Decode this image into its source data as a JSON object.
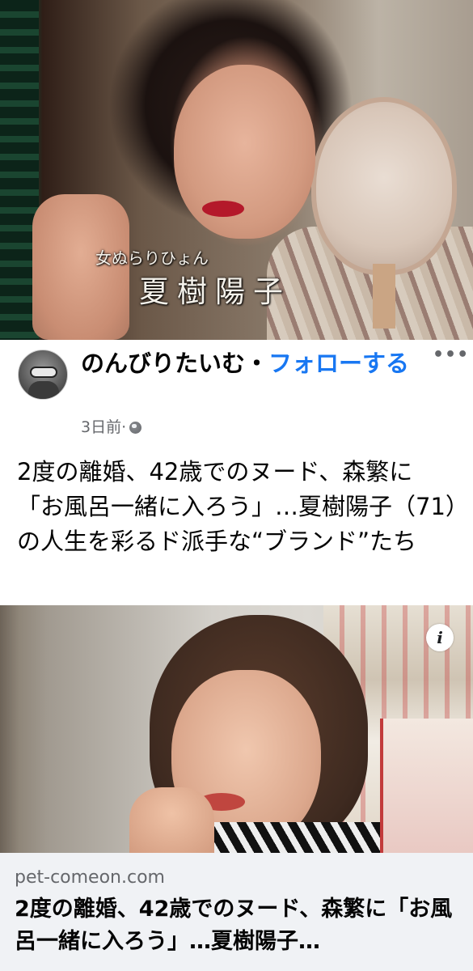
{
  "video_still": {
    "caption_small": "女ぬらりひょん",
    "caption_big": "夏樹陽子"
  },
  "post": {
    "author": "のんびりたいむ",
    "separator": "・",
    "follow_label": "フォローする",
    "more_label": "•••",
    "time": "3日前",
    "time_separator": " · ",
    "privacy_icon": "globe-icon",
    "text": "2度の離婚、42歳でのヌード、森繁に「お風呂一緒に入ろう」…夏樹陽子（71）の人生を彩るド派手な“ブランド”たち"
  },
  "link_preview": {
    "info_label": "i",
    "domain": "pet-comeon.com",
    "title": "2度の離婚、42歳でのヌード、森繁に「お風呂一緒に入ろう」…夏樹陽子…"
  },
  "colors": {
    "link_blue": "#1877f2",
    "secondary_text": "#65676b",
    "footer_bg": "#f0f2f5"
  }
}
